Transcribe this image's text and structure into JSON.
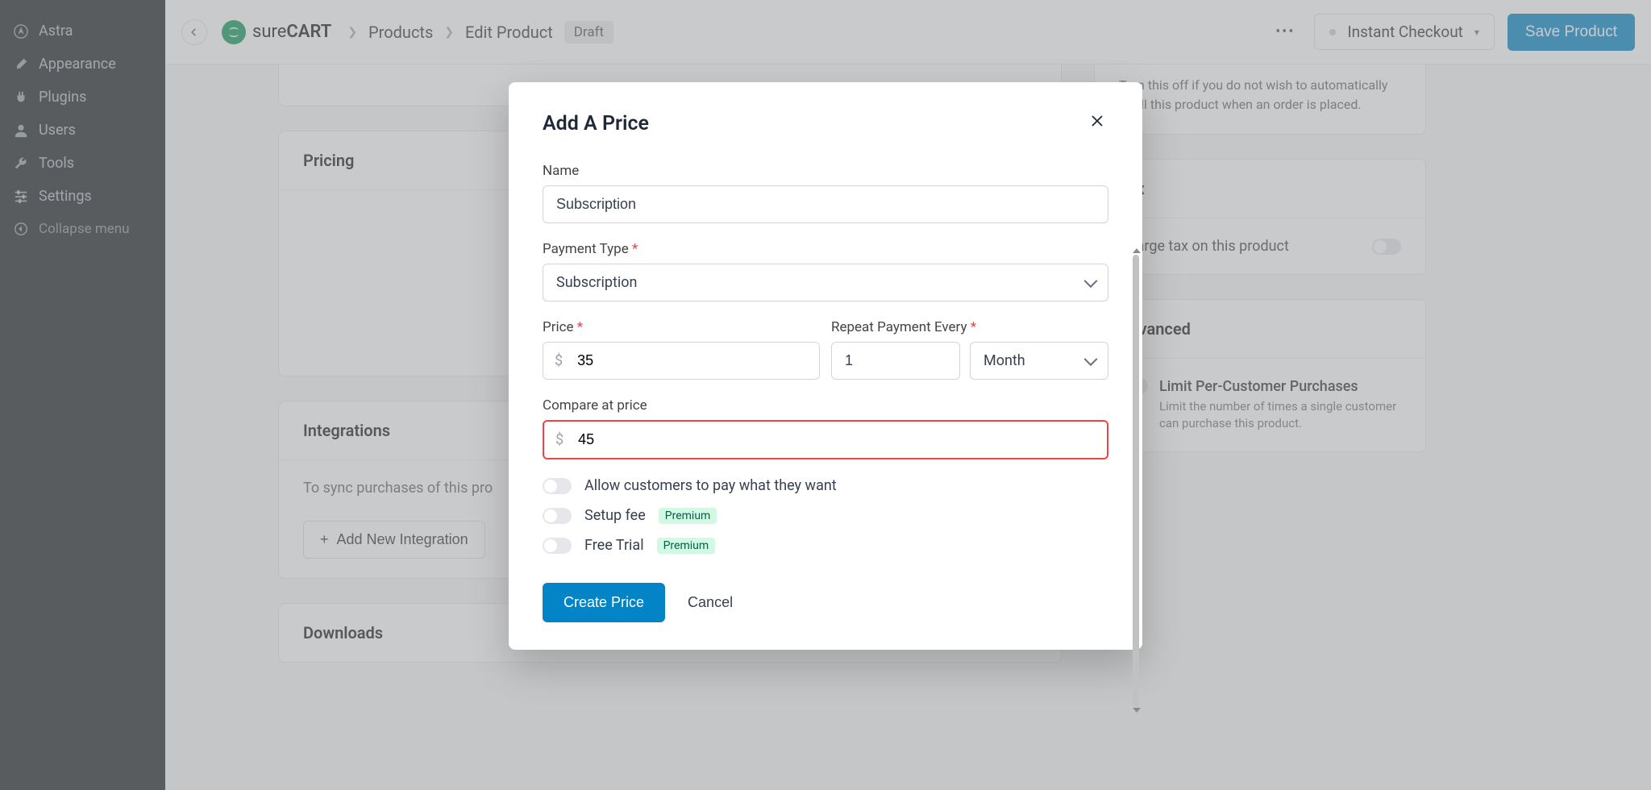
{
  "sidebar": {
    "items": [
      {
        "label": "Astra",
        "icon": "astra"
      },
      {
        "label": "Appearance",
        "icon": "brush"
      },
      {
        "label": "Plugins",
        "icon": "plug"
      },
      {
        "label": "Users",
        "icon": "user"
      },
      {
        "label": "Tools",
        "icon": "wrench"
      },
      {
        "label": "Settings",
        "icon": "sliders"
      },
      {
        "label": "Collapse menu",
        "icon": "collapse"
      }
    ]
  },
  "header": {
    "logo_prefix": "sure",
    "logo_suffix": "CART",
    "breadcrumb": [
      "Products",
      "Edit Product"
    ],
    "status": "Draft",
    "instant_checkout": "Instant Checkout",
    "save": "Save Product"
  },
  "main": {
    "pricing": {
      "title": "Pricing"
    },
    "integrations": {
      "title": "Integrations",
      "desc_prefix": "To sync purchases of this pro",
      "add_button": "Add New Integration"
    },
    "downloads": {
      "title": "Downloads"
    },
    "fulfillment_help": "Turn this off if you do not wish to automatically fulfill this product when an order is placed.",
    "tax": {
      "title": "Tax",
      "charge": "Charge tax on this product"
    },
    "advanced": {
      "title": "Advanced",
      "limit_title": "Limit Per-Customer Purchases",
      "limit_desc": "Limit the number of times a single customer can purchase this product."
    }
  },
  "modal": {
    "title": "Add A Price",
    "name": {
      "label": "Name",
      "value": "Subscription"
    },
    "payment_type": {
      "label": "Payment Type",
      "value": "Subscription"
    },
    "price": {
      "label": "Price",
      "currency": "$",
      "value": "35"
    },
    "repeat": {
      "label": "Repeat Payment Every",
      "interval_value": "1",
      "unit": "Month"
    },
    "compare": {
      "label": "Compare at price",
      "currency": "$",
      "value": "45"
    },
    "toggles": {
      "pay_what": "Allow customers to pay what they want",
      "setup_fee": "Setup fee",
      "free_trial": "Free Trial",
      "premium": "Premium"
    },
    "actions": {
      "create": "Create Price",
      "cancel": "Cancel"
    }
  }
}
